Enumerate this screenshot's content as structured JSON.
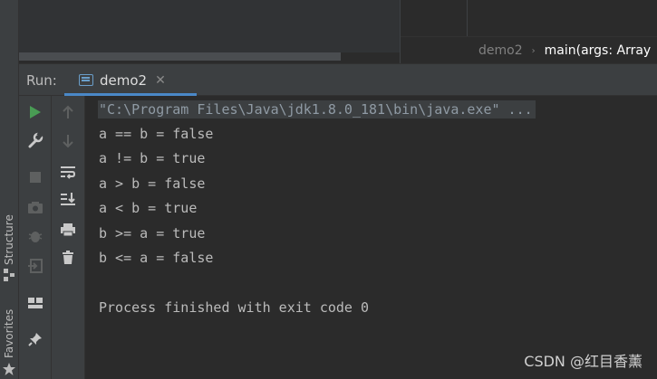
{
  "breadcrumb": {
    "file": "demo2",
    "separator": "›",
    "method": "main(args: Array"
  },
  "run_window": {
    "label": "Run:",
    "tab_label": "demo2",
    "tab_close": "✕"
  },
  "side_labels": {
    "structure": "Structure",
    "favorites": "Favorites"
  },
  "console": {
    "command": "\"C:\\Program Files\\Java\\jdk1.8.0_181\\bin\\java.exe\" ...",
    "lines": [
      "a == b = false",
      "a != b = true",
      "a > b = false",
      "a < b = true",
      "b >= a = true",
      "b <= a = false"
    ],
    "exit_message": "Process finished with exit code 0"
  },
  "watermark": "CSDN @红目香薰",
  "colors": {
    "run_green": "#499c54",
    "accent_blue": "#4a88c7",
    "background": "#2b2b2b",
    "panel": "#3c3f41"
  }
}
